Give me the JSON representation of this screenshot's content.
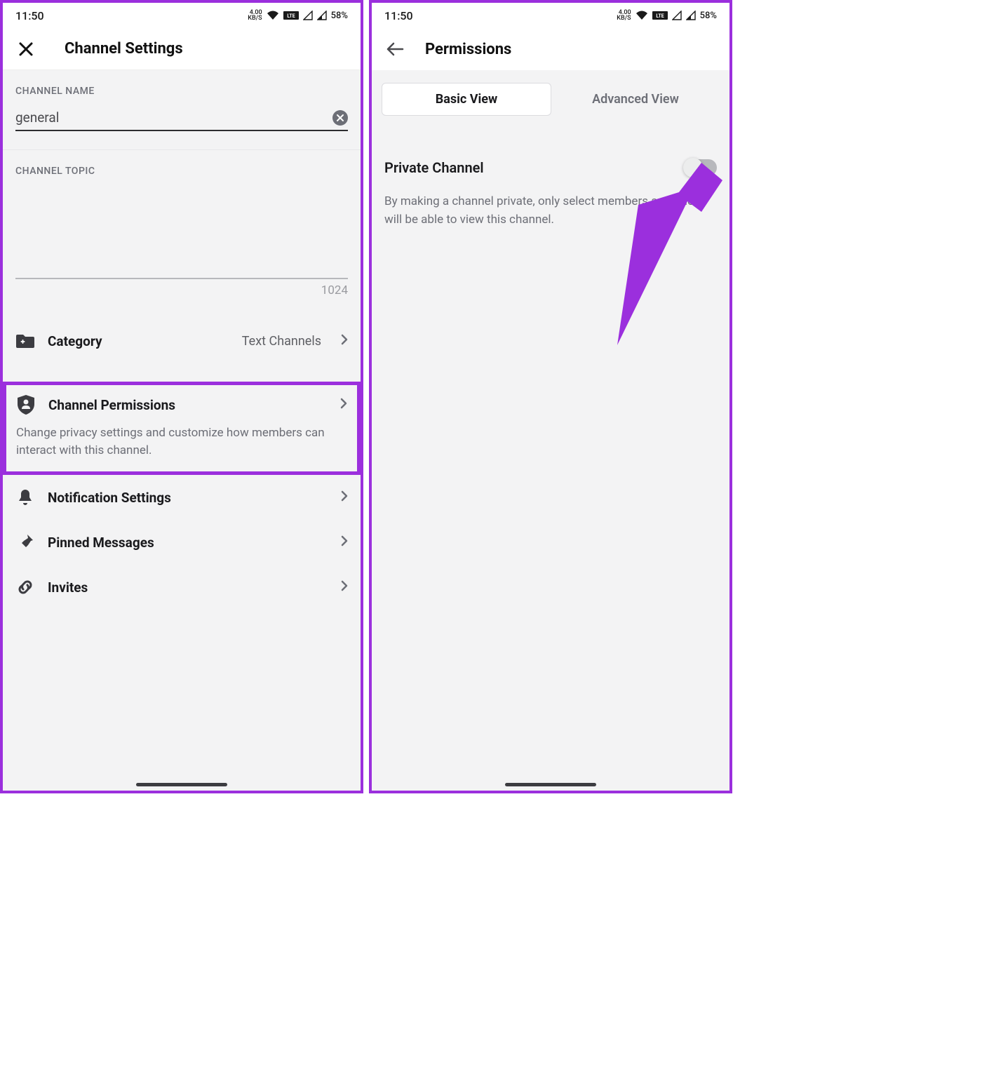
{
  "status": {
    "time": "11:50",
    "kbs_top": "4.00",
    "kbs_bot": "KB/S",
    "battery": "58%"
  },
  "left": {
    "title": "Channel Settings",
    "channel_name_label": "CHANNEL NAME",
    "channel_name_value": "general",
    "channel_topic_label": "CHANNEL TOPIC",
    "char_count": "1024",
    "category_label": "Category",
    "category_value": "Text Channels",
    "permissions_label": "Channel Permissions",
    "permissions_desc": "Change privacy settings and customize how members can interact with this channel.",
    "notifications_label": "Notification Settings",
    "pinned_label": "Pinned Messages",
    "invites_label": "Invites"
  },
  "right": {
    "title": "Permissions",
    "tab_basic": "Basic View",
    "tab_advanced": "Advanced View",
    "private_label": "Private Channel",
    "private_desc": "By making a channel private, only select members and roles will be able to view this channel."
  }
}
